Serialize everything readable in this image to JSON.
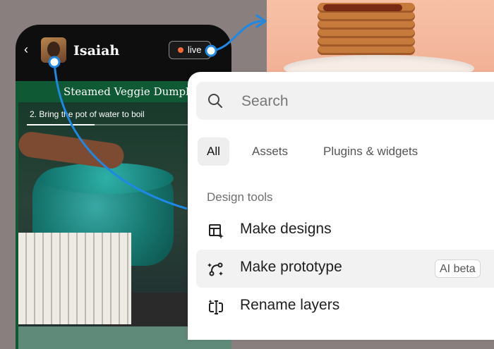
{
  "phone": {
    "back_glyph": "‹",
    "user_name": "Isaiah",
    "live_label": "live",
    "recipe_title": "Steamed Veggie Dumplings",
    "step_text": "2. Bring the pot of water to boil",
    "step_progress": 0.4
  },
  "search_panel": {
    "search_placeholder": "Search",
    "tabs": [
      {
        "label": "All",
        "active": true
      },
      {
        "label": "Assets",
        "active": false
      },
      {
        "label": "Plugins & widgets",
        "active": false
      }
    ],
    "section_title": "Design tools",
    "items": [
      {
        "label": "Make designs",
        "icon": "make-designs-icon"
      },
      {
        "label": "Make prototype",
        "icon": "make-prototype-icon",
        "badge": "AI beta",
        "highlighted": true
      },
      {
        "label": "Rename layers",
        "icon": "rename-layers-icon"
      }
    ]
  },
  "colors": {
    "accent_blue": "#1e88e5",
    "recipe_green": "#0f5a34",
    "live_dot": "#f36b3c",
    "background": "#8a7f7f"
  }
}
